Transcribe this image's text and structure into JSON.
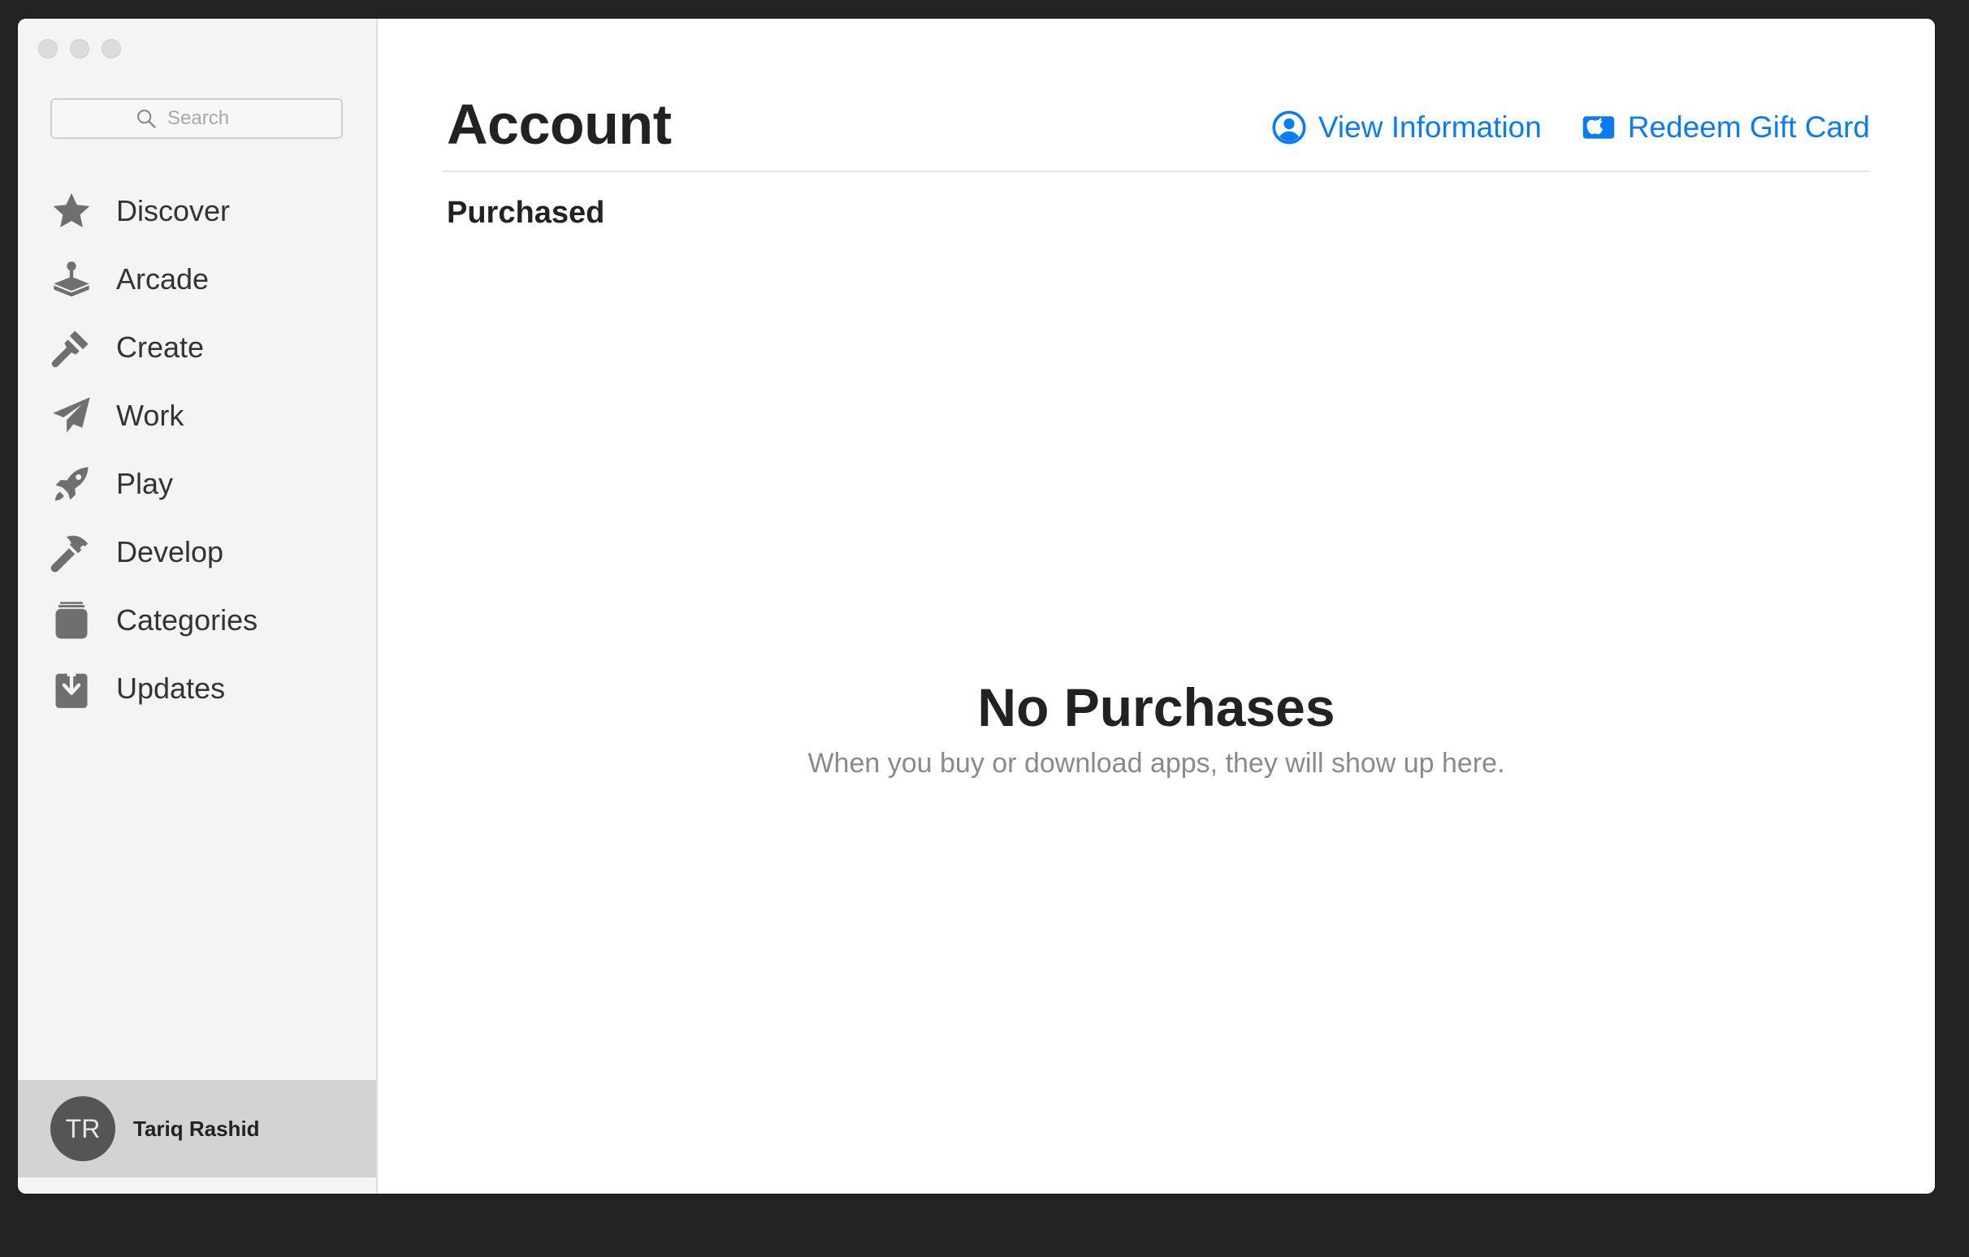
{
  "window": {
    "traffic_lights": [
      "close",
      "minimize",
      "zoom"
    ]
  },
  "sidebar": {
    "search": {
      "placeholder": "Search",
      "value": ""
    },
    "items": [
      {
        "label": "Discover",
        "icon": "star-icon"
      },
      {
        "label": "Arcade",
        "icon": "joystick-icon"
      },
      {
        "label": "Create",
        "icon": "brush-icon"
      },
      {
        "label": "Work",
        "icon": "paper-plane-icon"
      },
      {
        "label": "Play",
        "icon": "rocket-icon"
      },
      {
        "label": "Develop",
        "icon": "hammer-icon"
      },
      {
        "label": "Categories",
        "icon": "stack-icon"
      },
      {
        "label": "Updates",
        "icon": "download-icon"
      }
    ],
    "account": {
      "initials": "TR",
      "name": "Tariq Rashid"
    }
  },
  "main": {
    "title": "Account",
    "actions": {
      "view_information": "View Information",
      "redeem_gift_card": "Redeem Gift Card"
    },
    "section": "Purchased",
    "empty_state": {
      "title": "No Purchases",
      "subtitle": "When you buy or download apps, they will show up here."
    }
  },
  "colors": {
    "accent": "#0a7cf2",
    "sidebar_bg": "#f4f4f4",
    "icon_gray": "#6f6f6f",
    "footer_bg": "#d3d3d3"
  }
}
